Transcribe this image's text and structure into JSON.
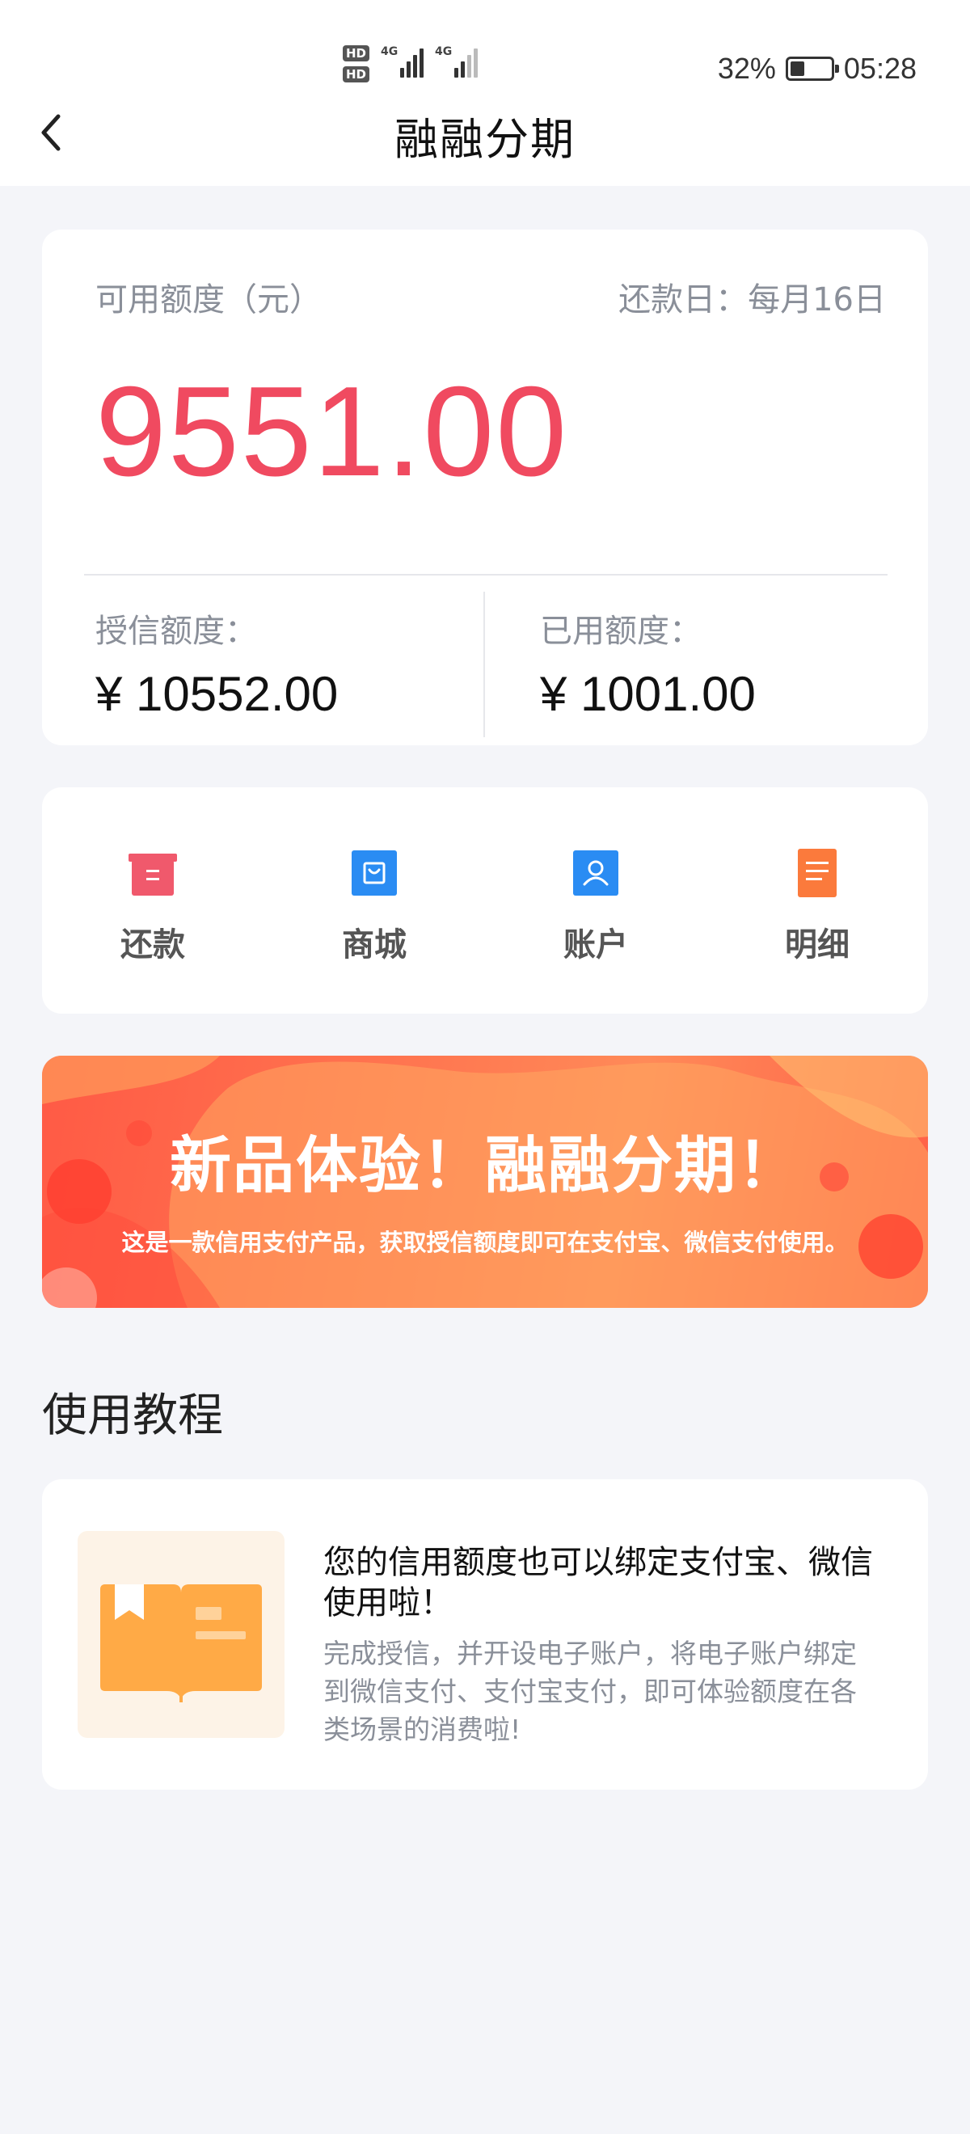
{
  "status_bar": {
    "hd1": "HD",
    "hd2": "HD",
    "network1": "4G",
    "network2": "4G",
    "battery": "32%",
    "time": "05:28"
  },
  "header": {
    "title": "融融分期"
  },
  "credit": {
    "available_label": "可用额度（元）",
    "repay_day": "还款日：每月16日",
    "available_amount": "9551.00",
    "granted_label": "授信额度：",
    "granted_value": "¥ 10552.00",
    "used_label": "已用额度：",
    "used_value": "¥ 1001.00"
  },
  "menu": {
    "items": [
      {
        "label": "还款",
        "icon": "repay-icon",
        "color": "#f0596c"
      },
      {
        "label": "商城",
        "icon": "shop-icon",
        "color": "#2a8cf3"
      },
      {
        "label": "账户",
        "icon": "account-icon",
        "color": "#2a8cf3"
      },
      {
        "label": "明细",
        "icon": "detail-icon",
        "color": "#fb7a3c"
      }
    ]
  },
  "banner": {
    "title": "新品体验！融融分期！",
    "subtitle": "这是一款信用支付产品，获取授信额度即可在支付宝、微信支付使用。"
  },
  "tutorial": {
    "section_title": "使用教程",
    "card_title": "您的信用额度也可以绑定支付宝、微信使用啦！",
    "card_desc": "完成授信，并开设电子账户，将电子账户绑定到微信支付、支付宝支付，即可体验额度在各类场景的消费啦!",
    "thumb_icon": "book-icon"
  },
  "colors": {
    "accent_red": "#f04a60",
    "banner_orange": "#ff7650",
    "background": "#f4f5f9"
  }
}
